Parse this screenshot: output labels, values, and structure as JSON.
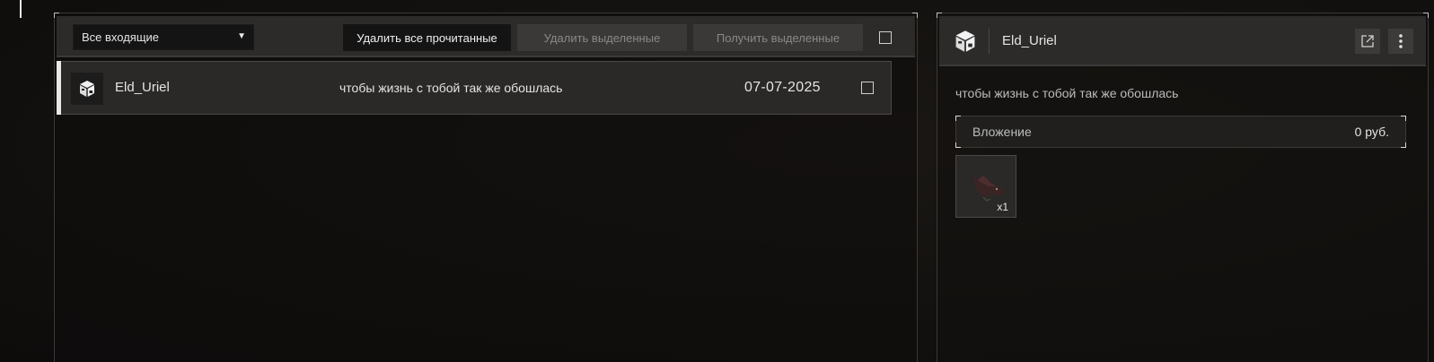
{
  "mail_list": {
    "filter": {
      "selected": "Все входящие"
    },
    "toolbar": {
      "delete_read_label": "Удалить все прочитанные",
      "delete_selected_label": "Удалить выделенные",
      "receive_selected_label": "Получить выделенные"
    },
    "rows": [
      {
        "icon": "package-icon",
        "sender": "Eld_Uriel",
        "subject": "чтобы жизнь с тобой так же обошлась",
        "date": "07-07-2025"
      }
    ]
  },
  "detail": {
    "sender": "Eld_Uriel",
    "icon": "package-icon",
    "actions": [
      "external-link-icon",
      "more-vertical-icon"
    ],
    "body": "чтобы жизнь с тобой так же обошлась",
    "attachment": {
      "label": "Вложение",
      "amount": "0  руб."
    },
    "items": [
      {
        "icon": "rat-trophy-icon",
        "quantity": "x1"
      }
    ]
  },
  "colors": {
    "panel_header": "#2c2b2a",
    "row_bg": "#2a2928",
    "active_button": "#141414",
    "disabled_button": "#3a3938",
    "accent": "#e8e8e8"
  }
}
